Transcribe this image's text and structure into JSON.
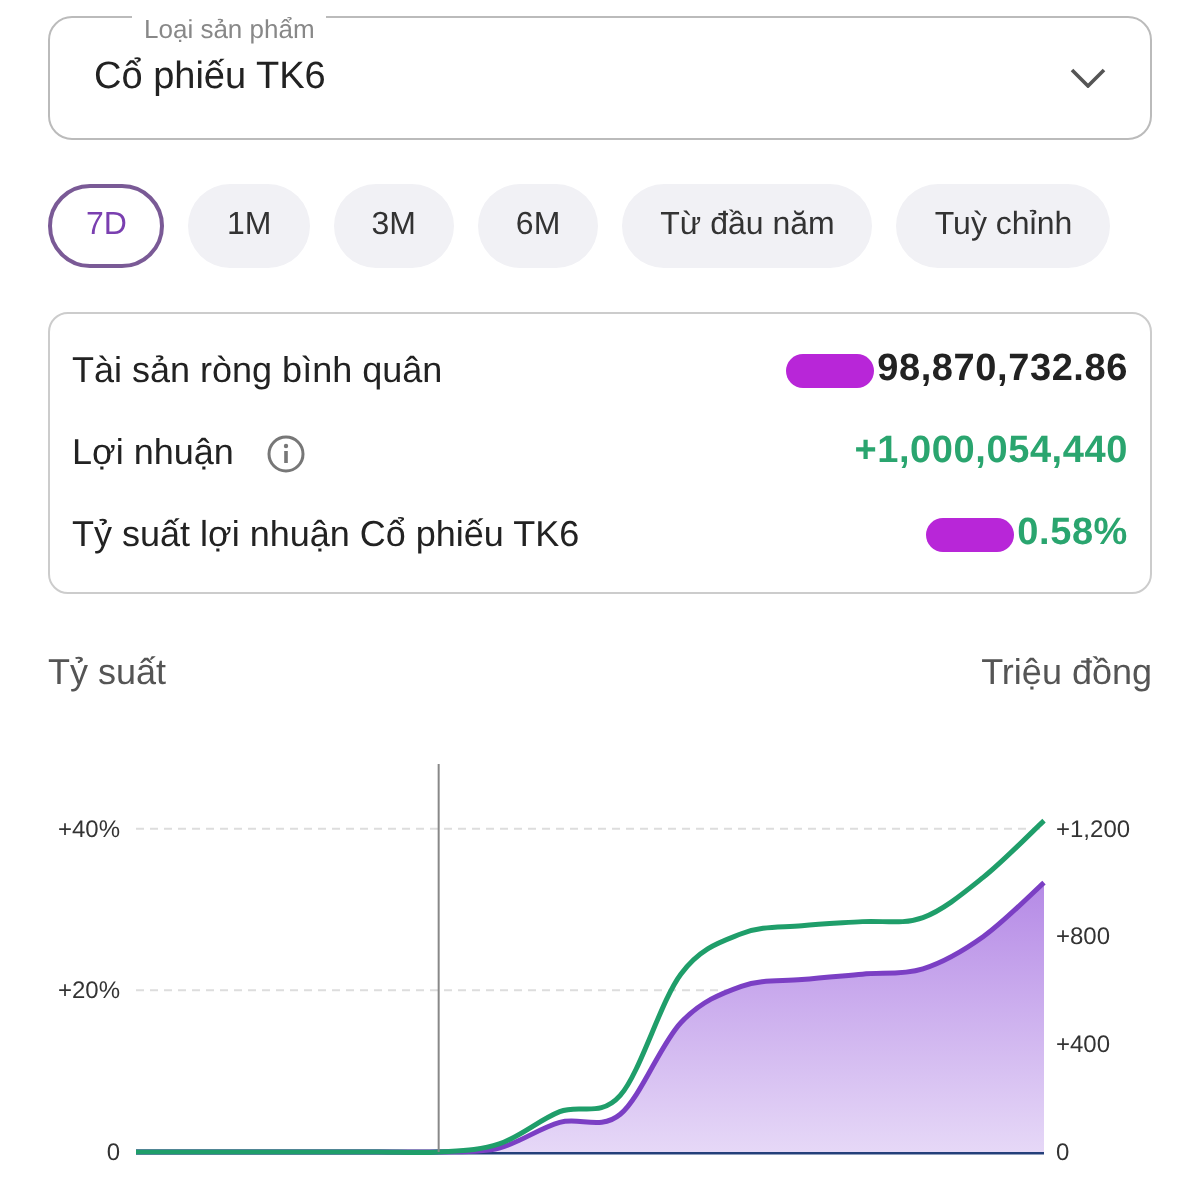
{
  "product_select": {
    "label": "Loại sản phẩm",
    "value": "Cổ phiếu TK6"
  },
  "periods": [
    {
      "label": "7D",
      "selected": true
    },
    {
      "label": "1M",
      "selected": false
    },
    {
      "label": "3M",
      "selected": false
    },
    {
      "label": "6M",
      "selected": false
    },
    {
      "label": "Từ đầu năm",
      "selected": false
    },
    {
      "label": "Tuỳ chỉnh",
      "selected": false
    }
  ],
  "summary": [
    {
      "label": "Tài sản ròng bình quân",
      "value": "98,870,732.86",
      "kind": "plain",
      "redacted": true,
      "info": false
    },
    {
      "label": "Lợi nhuận",
      "value": "+1,000,054,440",
      "kind": "gain",
      "redacted": false,
      "info": true
    },
    {
      "label": "Tỷ suất lợi nhuận Cổ phiếu TK6",
      "value": "0.58%",
      "kind": "gain",
      "redacted": true,
      "info": false
    }
  ],
  "chart": {
    "chart_data": {
      "type": "area",
      "series": [
        {
          "name": "Tỷ suất",
          "color": "#1f9e6a",
          "type": "line",
          "values": [
            0,
            0,
            0,
            0,
            0,
            0,
            1,
            5,
            7,
            22,
            27,
            28,
            28.5,
            29,
            34,
            41
          ]
        },
        {
          "name": "Triệu đồng",
          "color": "#7b3fc4",
          "axis": "y2",
          "values": [
            0,
            0,
            0,
            0,
            0,
            0,
            15,
            110,
            140,
            480,
            615,
            640,
            660,
            680,
            800,
            1000
          ]
        }
      ],
      "ylim": [
        0,
        48
      ],
      "y2lim": [
        0,
        1440
      ],
      "yticks": [
        {
          "value": 0,
          "label": "0"
        },
        {
          "value": 20,
          "label": "+20%"
        },
        {
          "value": 40,
          "label": "+40%"
        }
      ],
      "y2ticks": [
        {
          "value": 0,
          "label": "0"
        },
        {
          "value": 400,
          "label": "+400"
        },
        {
          "value": 800,
          "label": "+800"
        },
        {
          "value": 1200,
          "label": "+1,200"
        }
      ]
    }
  }
}
